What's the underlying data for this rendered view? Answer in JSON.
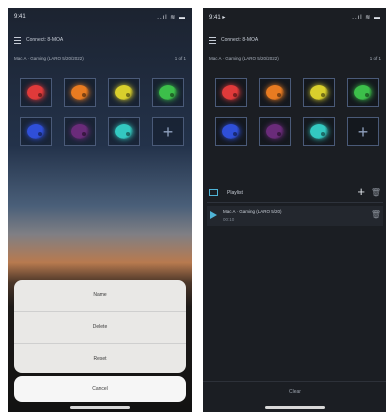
{
  "phones": {
    "left": {
      "status": {
        "time": "9:41",
        "icons": "..ıl ≋ ▬"
      },
      "title": "Connect: 8-MOA",
      "subtitle": "Mac A · Gaming (LARO 5/20/2022)",
      "count": "1 of 1",
      "tiles": [
        {
          "name": "palette-red-icon",
          "color": "#e03a3a"
        },
        {
          "name": "palette-orange-icon",
          "color": "#e87b21"
        },
        {
          "name": "palette-yellow-icon",
          "color": "#d9cf2c"
        },
        {
          "name": "palette-green-icon",
          "color": "#3cbf4a"
        },
        {
          "name": "palette-blue-icon",
          "color": "#2f4fd8"
        },
        {
          "name": "palette-purple-icon",
          "color": "#6a2b7a"
        },
        {
          "name": "palette-cyan-icon",
          "color": "#33c9c1"
        }
      ],
      "sheet": {
        "options": [
          "Name",
          "Delete",
          "Reset"
        ],
        "cancel": "Cancel"
      }
    },
    "right": {
      "status": {
        "time": "9:41 ▸",
        "icons": "..ıl ≋ ▬"
      },
      "title": "Connect: 8-MOA",
      "subtitle": "Mac A · Gaming (LARO 5/20/2022)",
      "count": "1 of 1",
      "tiles": [
        {
          "name": "palette-red-icon",
          "color": "#e03a3a"
        },
        {
          "name": "palette-orange-icon",
          "color": "#e87b21"
        },
        {
          "name": "palette-yellow-icon",
          "color": "#d9cf2c"
        },
        {
          "name": "palette-green-icon",
          "color": "#3cbf4a"
        },
        {
          "name": "palette-blue-icon",
          "color": "#2f4fd8"
        },
        {
          "name": "palette-purple-icon",
          "color": "#6a2b7a"
        },
        {
          "name": "palette-cyan-icon",
          "color": "#33c9c1"
        }
      ],
      "playlist": {
        "label": "Playlist",
        "item": {
          "name": "Mac A · Gaming (LARO 5/20)",
          "duration": "00:10"
        }
      },
      "footer": "Clear"
    }
  },
  "colors": {
    "accent": "#4fb4d6",
    "tile_border": "#4a5a78"
  }
}
